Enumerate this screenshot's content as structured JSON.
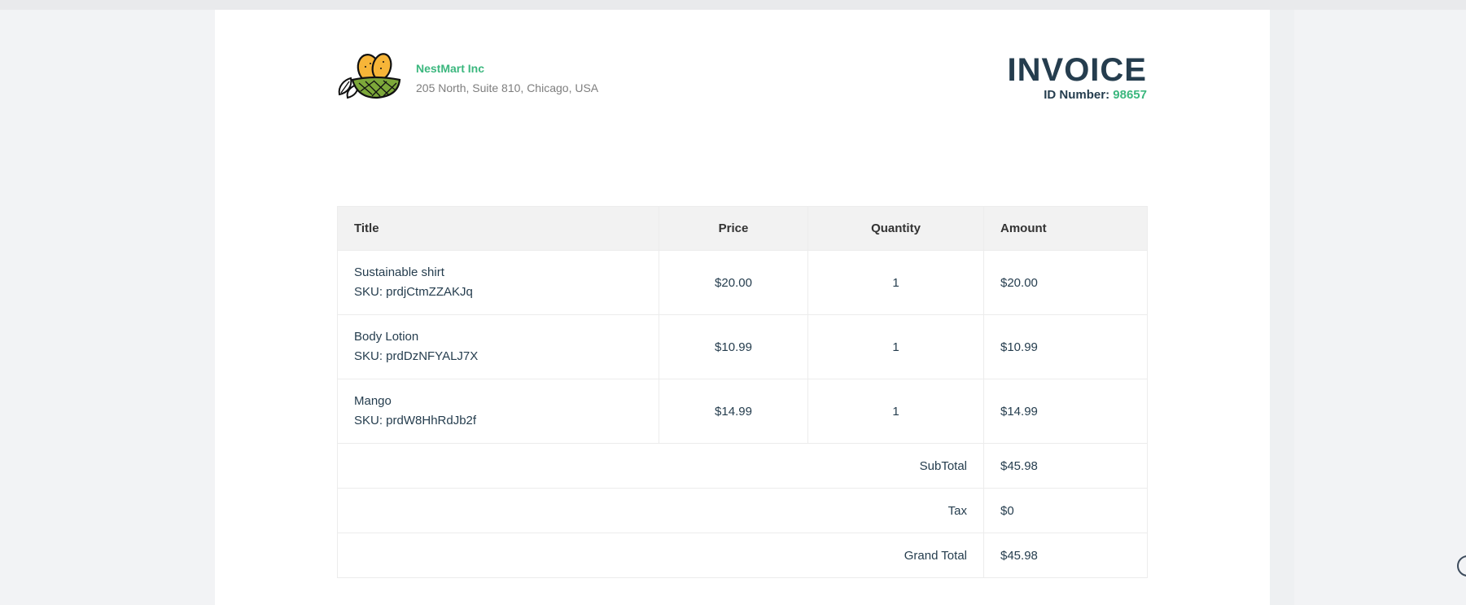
{
  "company": {
    "name": "NestMart Inc",
    "address": "205 North, Suite 810, Chicago, USA"
  },
  "invoice": {
    "title": "INVOICE",
    "id_label": "ID Number:",
    "id_value": "98657"
  },
  "table": {
    "headers": [
      "Title",
      "Price",
      "Quantity",
      "Amount"
    ],
    "items": [
      {
        "title": "Sustainable shirt",
        "sku": "SKU: prdjCtmZZAKJq",
        "price": "$20.00",
        "quantity": "1",
        "amount": "$20.00"
      },
      {
        "title": "Body Lotion",
        "sku": "SKU: prdDzNFYALJ7X",
        "price": "$10.99",
        "quantity": "1",
        "amount": "$10.99"
      },
      {
        "title": "Mango",
        "sku": "SKU: prdW8HhRdJb2f",
        "price": "$14.99",
        "quantity": "1",
        "amount": "$14.99"
      }
    ],
    "summary": [
      {
        "label": "SubTotal",
        "value": "$45.98"
      },
      {
        "label": "Tax",
        "value": "$0"
      },
      {
        "label": "Grand Total",
        "value": "$45.98"
      }
    ]
  },
  "colors": {
    "accent": "#3bb77e",
    "heading": "#253d4e"
  }
}
